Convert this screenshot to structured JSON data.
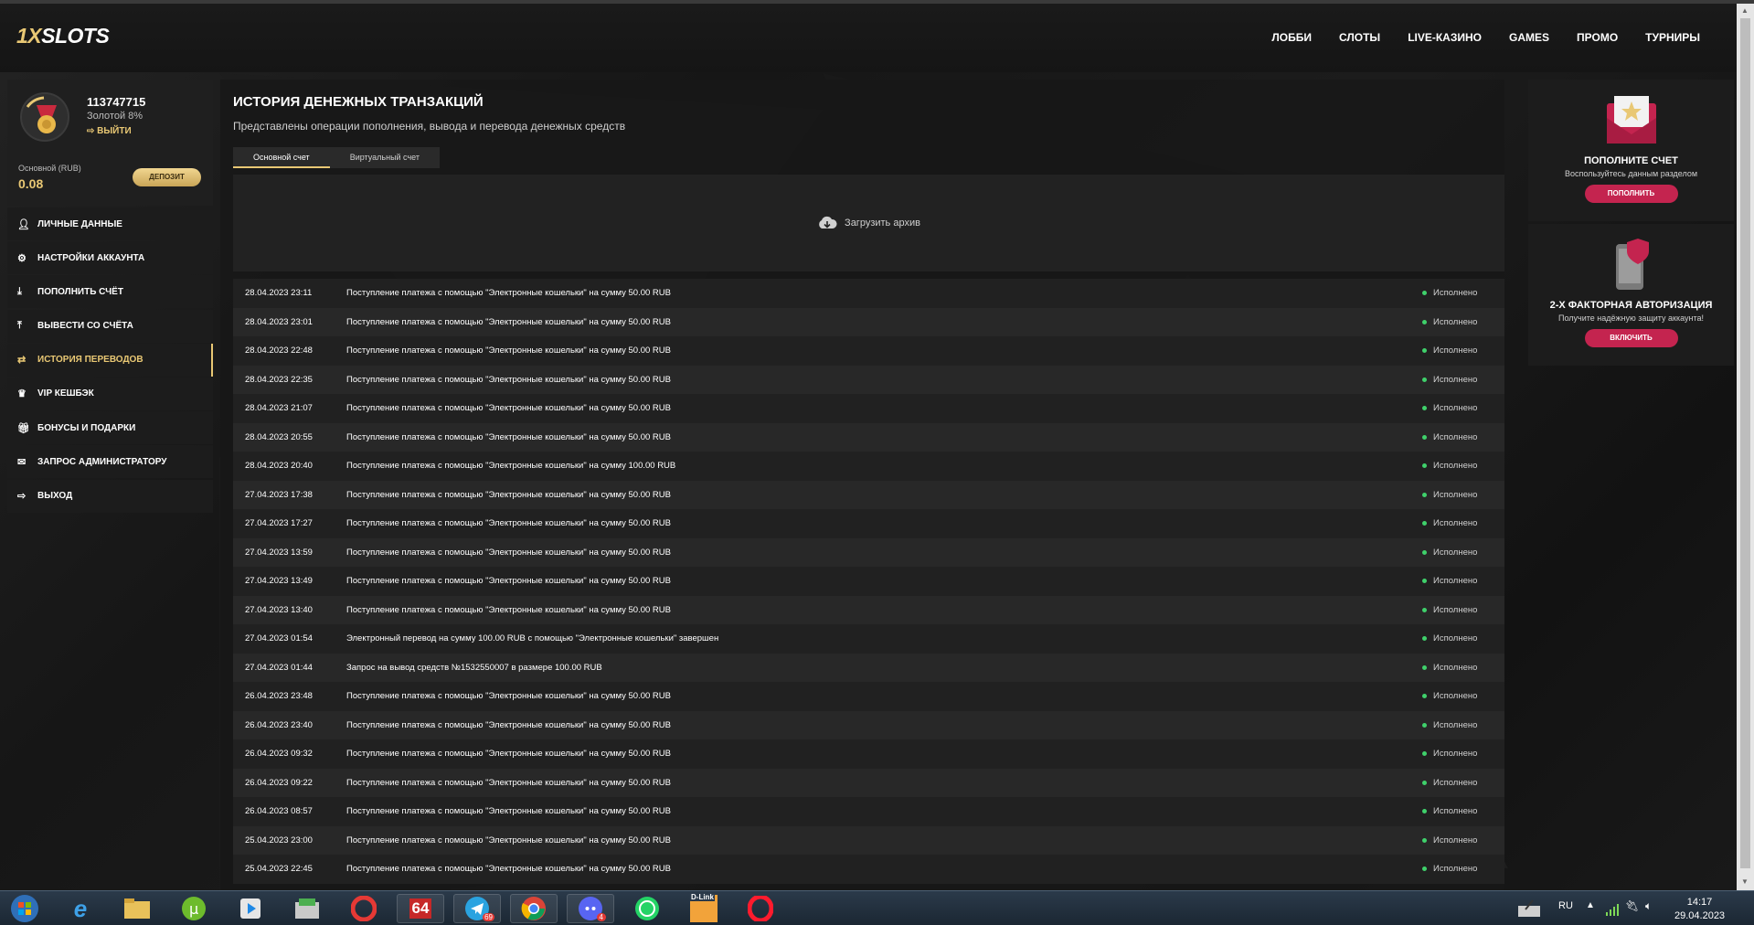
{
  "brand": {
    "logo_part1": "1X",
    "logo_part2": "SLOTS"
  },
  "nav": [
    "ЛОББИ",
    "СЛОТЫ",
    "LIVE-КАЗИНО",
    "GAMES",
    "ПРОМО",
    "ТУРНИРЫ"
  ],
  "profile": {
    "user_id": "113747715",
    "level": "Золотой 8%",
    "logout_link": "ВЫЙТИ",
    "balance_label": "Основной (RUB)",
    "balance_value": "0.08",
    "deposit_button": "ДЕПОЗИТ"
  },
  "menu": [
    {
      "label": "ЛИЧНЫЕ ДАННЫЕ",
      "icon": "user-icon"
    },
    {
      "label": "НАСТРОЙКИ АККАУНТА",
      "icon": "settings-icon"
    },
    {
      "label": "ПОПОЛНИТЬ СЧЁТ",
      "icon": "download-icon"
    },
    {
      "label": "ВЫВЕСТИ СО СЧЁТА",
      "icon": "upload-icon"
    },
    {
      "label": "ИСТОРИЯ ПЕРЕВОДОВ",
      "icon": "transfer-icon",
      "active": true
    },
    {
      "label": "VIP КЕШБЭК",
      "icon": "crown-icon"
    },
    {
      "label": "БОНУСЫ И ПОДАРКИ",
      "icon": "gift-icon"
    },
    {
      "label": "ЗАПРОС АДМИНИСТРАТОРУ",
      "icon": "mail-icon"
    },
    {
      "label": "ВЫХОД",
      "icon": "exit-icon"
    }
  ],
  "main": {
    "title": "ИСТОРИЯ ДЕНЕЖНЫХ ТРАНЗАКЦИЙ",
    "subtitle": "Представлены операции пополнения, вывода и перевода денежных средств",
    "tabs": [
      "Основной счет",
      "Виртуальный счет"
    ],
    "archive_label": "Загрузить архив"
  },
  "transactions": [
    {
      "date": "28.04.2023 23:11",
      "desc": "Поступление платежа с помощью \"Электронные кошельки\" на сумму 50.00 RUB",
      "status": "Исполнено"
    },
    {
      "date": "28.04.2023 23:01",
      "desc": "Поступление платежа с помощью \"Электронные кошельки\" на сумму 50.00 RUB",
      "status": "Исполнено"
    },
    {
      "date": "28.04.2023 22:48",
      "desc": "Поступление платежа с помощью \"Электронные кошельки\" на сумму 50.00 RUB",
      "status": "Исполнено"
    },
    {
      "date": "28.04.2023 22:35",
      "desc": "Поступление платежа с помощью \"Электронные кошельки\" на сумму 50.00 RUB",
      "status": "Исполнено"
    },
    {
      "date": "28.04.2023 21:07",
      "desc": "Поступление платежа с помощью \"Электронные кошельки\" на сумму 50.00 RUB",
      "status": "Исполнено"
    },
    {
      "date": "28.04.2023 20:55",
      "desc": "Поступление платежа с помощью \"Электронные кошельки\" на сумму 50.00 RUB",
      "status": "Исполнено"
    },
    {
      "date": "28.04.2023 20:40",
      "desc": "Поступление платежа с помощью \"Электронные кошельки\" на сумму 100.00 RUB",
      "status": "Исполнено"
    },
    {
      "date": "27.04.2023 17:38",
      "desc": "Поступление платежа с помощью \"Электронные кошельки\" на сумму 50.00 RUB",
      "status": "Исполнено"
    },
    {
      "date": "27.04.2023 17:27",
      "desc": "Поступление платежа с помощью \"Электронные кошельки\" на сумму 50.00 RUB",
      "status": "Исполнено"
    },
    {
      "date": "27.04.2023 13:59",
      "desc": "Поступление платежа с помощью \"Электронные кошельки\" на сумму 50.00 RUB",
      "status": "Исполнено"
    },
    {
      "date": "27.04.2023 13:49",
      "desc": "Поступление платежа с помощью \"Электронные кошельки\" на сумму 50.00 RUB",
      "status": "Исполнено"
    },
    {
      "date": "27.04.2023 13:40",
      "desc": "Поступление платежа с помощью \"Электронные кошельки\" на сумму 50.00 RUB",
      "status": "Исполнено"
    },
    {
      "date": "27.04.2023 01:54",
      "desc": "Электронный перевод на сумму 100.00 RUB с помощью \"Электронные кошельки\" завершен",
      "status": "Исполнено"
    },
    {
      "date": "27.04.2023 01:44",
      "desc": "Запрос на вывод средств №1532550007 в размере 100.00 RUB",
      "status": "Исполнено"
    },
    {
      "date": "26.04.2023 23:48",
      "desc": "Поступление платежа с помощью \"Электронные кошельки\" на сумму 50.00 RUB",
      "status": "Исполнено"
    },
    {
      "date": "26.04.2023 23:40",
      "desc": "Поступление платежа с помощью \"Электронные кошельки\" на сумму 50.00 RUB",
      "status": "Исполнено"
    },
    {
      "date": "26.04.2023 09:32",
      "desc": "Поступление платежа с помощью \"Электронные кошельки\" на сумму 50.00 RUB",
      "status": "Исполнено"
    },
    {
      "date": "26.04.2023 09:22",
      "desc": "Поступление платежа с помощью \"Электронные кошельки\" на сумму 50.00 RUB",
      "status": "Исполнено"
    },
    {
      "date": "26.04.2023 08:57",
      "desc": "Поступление платежа с помощью \"Электронные кошельки\" на сумму 50.00 RUB",
      "status": "Исполнено"
    },
    {
      "date": "25.04.2023 23:00",
      "desc": "Поступление платежа с помощью \"Электронные кошельки\" на сумму 50.00 RUB",
      "status": "Исполнено"
    },
    {
      "date": "25.04.2023 22:45",
      "desc": "Поступление платежа с помощью \"Электронные кошельки\" на сумму 50.00 RUB",
      "status": "Исполнено"
    }
  ],
  "widgets": {
    "deposit": {
      "title": "ПОПОЛНИТЕ СЧЕТ",
      "subtitle": "Воспользуйтесь данным разделом",
      "button": "ПОПОЛНИТЬ"
    },
    "twofa": {
      "title": "2-Х ФАКТОРНАЯ АВТОРИЗАЦИЯ",
      "subtitle": "Получите надёжную защиту аккаунта!",
      "button": "ВКЛЮЧИТЬ"
    }
  },
  "taskbar": {
    "language": "RU",
    "time": "14:17",
    "date": "29.04.2023",
    "badge_telegram": "69",
    "badge_discord": "4",
    "label_aida": "64",
    "label_dlink": "D-Link"
  },
  "colors": {
    "accent_gold": "#e9c874",
    "accent_pink": "#c4244f",
    "status_green": "#3fd16b"
  }
}
